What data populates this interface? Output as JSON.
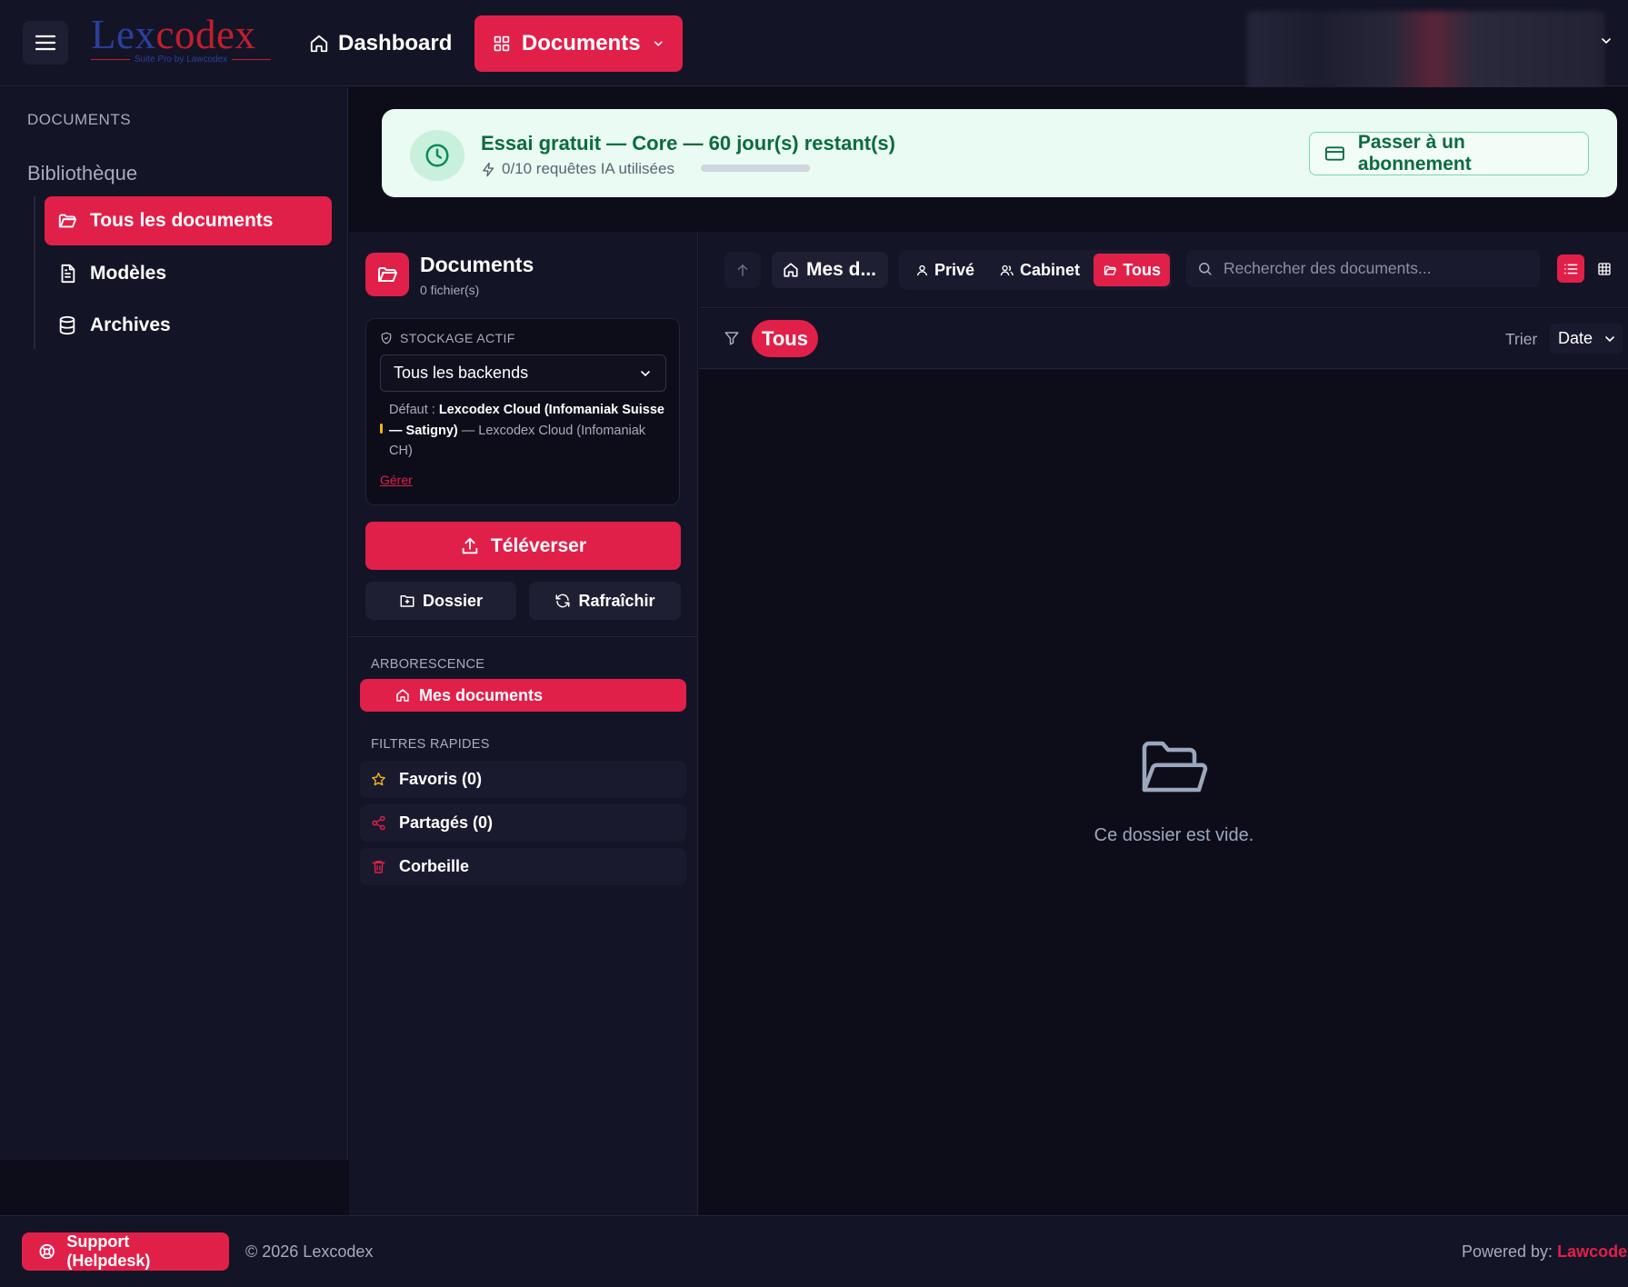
{
  "header": {
    "logo_text_1": "Lex",
    "logo_text_2": "codex",
    "logo_tagline": "Suite Pro by Lawcodex",
    "nav_dashboard": "Dashboard",
    "nav_documents": "Documents"
  },
  "sidebar": {
    "title": "DOCUMENTS",
    "section": "Bibliothèque",
    "items": [
      {
        "label": "Tous les documents",
        "icon": "folder-open-icon",
        "active": true
      },
      {
        "label": "Modèles",
        "icon": "file-text-icon",
        "active": false
      },
      {
        "label": "Archives",
        "icon": "database-icon",
        "active": false
      }
    ]
  },
  "banner": {
    "title": "Essai gratuit — Core — 60 jour(s) restant(s)",
    "subtitle": "0/10 requêtes IA utilisées",
    "usage_fraction": 0,
    "button": "Passer à un abonnement"
  },
  "panel": {
    "title": "Documents",
    "count": "0 fichier(s)",
    "storage_label": "STOCKAGE ACTIF",
    "storage_select": "Tous les backends",
    "default_prefix": "Défaut : ",
    "default_name": "Lexcodex Cloud (Infomaniak Suisse — Satigny)",
    "default_suffix": " — Lexcodex Cloud (Infomaniak CH)",
    "manage_link": "Gérer",
    "upload_button": "Téléverser",
    "folder_button": "Dossier",
    "refresh_button": "Rafraîchir",
    "tree_label": "ARBORESCENCE",
    "tree_item": "Mes documents",
    "quick_filters_label": "FILTRES RAPIDES",
    "quick_filters": [
      {
        "label": "Favoris (0)",
        "icon": "star-icon"
      },
      {
        "label": "Partagés (0)",
        "icon": "share-icon"
      },
      {
        "label": "Corbeille",
        "icon": "trash-icon"
      }
    ]
  },
  "toolbar": {
    "breadcrumb": "Mes d...",
    "scopes": [
      {
        "label": "Privé",
        "icon": "user-icon",
        "active": false
      },
      {
        "label": "Cabinet",
        "icon": "users-icon",
        "active": false
      },
      {
        "label": "Tous",
        "icon": "folder-icon",
        "active": true
      }
    ],
    "search_placeholder": "Rechercher des documents...",
    "filter_pill": "Tous",
    "sort_label": "Trier",
    "sort_value": "Date"
  },
  "empty_state": {
    "message": "Ce dossier est vide."
  },
  "footer": {
    "support": "Support (Helpdesk)",
    "copyright": "© 2026 Lexcodex",
    "powered_prefix": "Powered by: ",
    "powered_brand": "Lawcodex"
  },
  "colors": {
    "accent": "#e1204a",
    "background": "#0d0d1a",
    "panel": "#141427",
    "banner_bg": "#e9fbf2",
    "banner_text": "#0b6b3f"
  }
}
